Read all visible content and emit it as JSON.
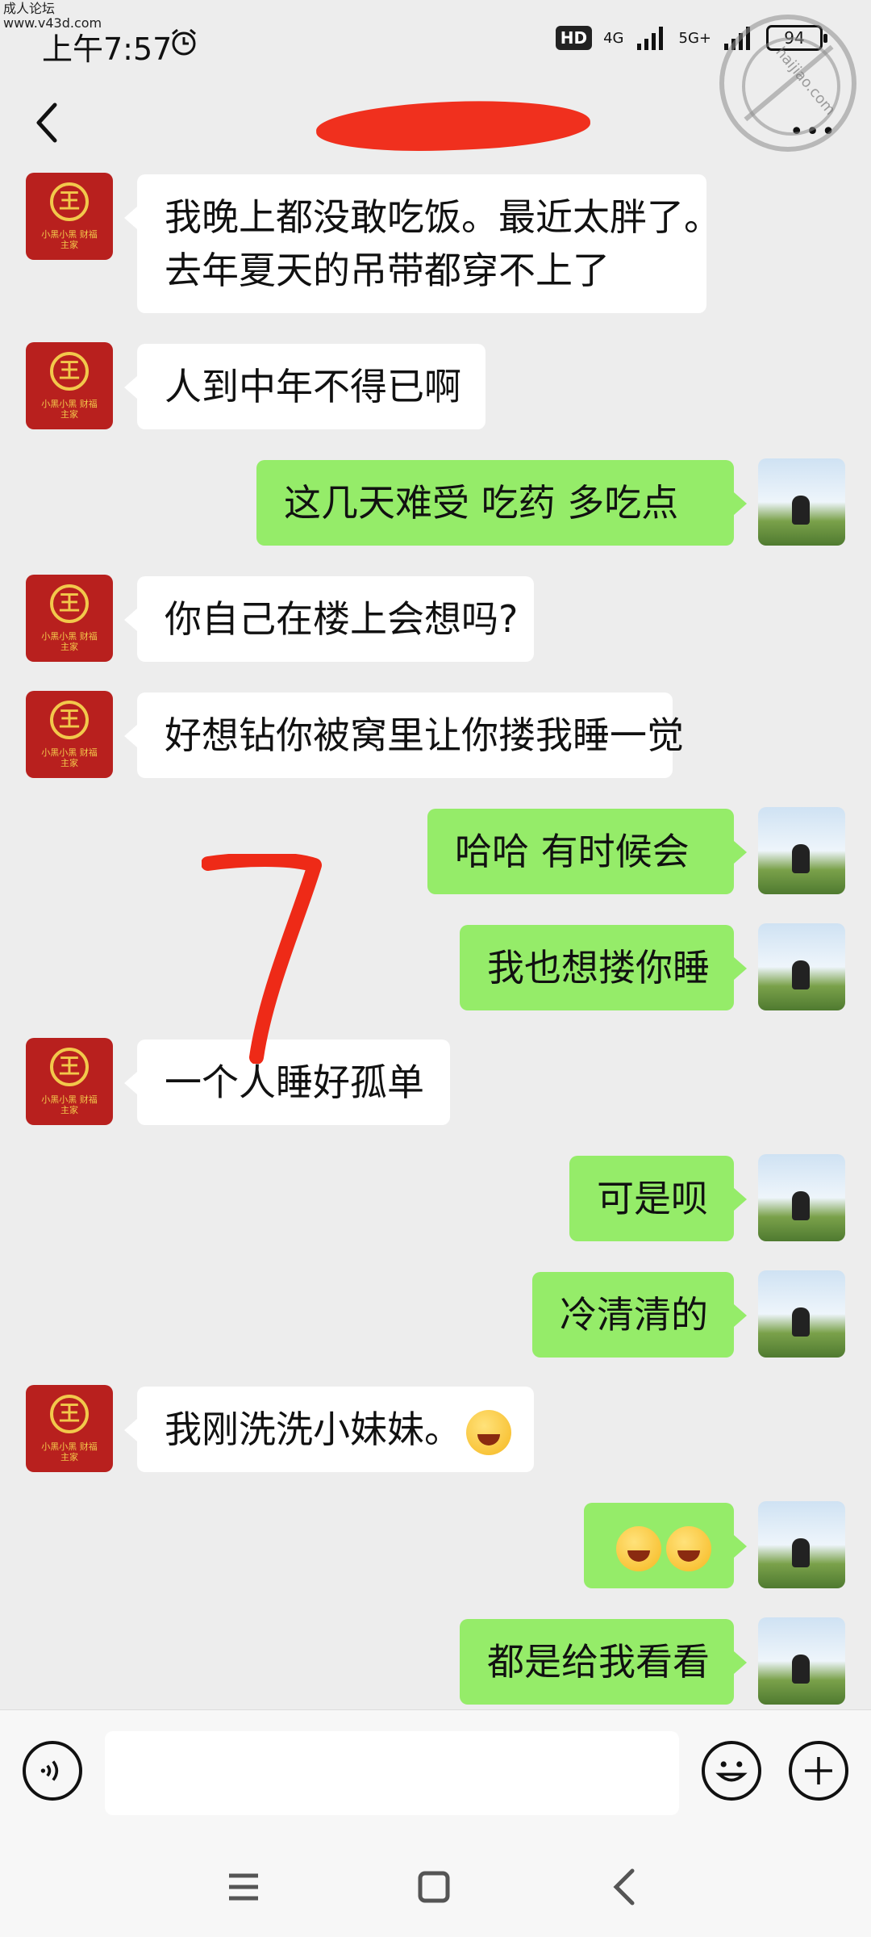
{
  "watermark": {
    "line1": "成人论坛",
    "line2": "www.v43d.com",
    "stamp_text": "haijiao.com"
  },
  "status_bar": {
    "time": "上午7:57",
    "hd": "HD",
    "net1": "4G",
    "net2": "5G+",
    "battery": "94"
  },
  "nav": {
    "title": "",
    "more": "•••"
  },
  "messages": [
    {
      "side": "left",
      "lines": [
        "我晚上都没敢吃饭。最近太胖了。",
        "去年夏天的吊带都穿不上了"
      ]
    },
    {
      "side": "left",
      "lines": [
        "人到中年不得已啊"
      ]
    },
    {
      "side": "right",
      "lines": [
        "这几天难受   吃药   多吃点"
      ]
    },
    {
      "side": "left",
      "lines": [
        "你自己在楼上会想吗?"
      ]
    },
    {
      "side": "left",
      "lines": [
        "好想钻你被窝里让你搂我睡一觉"
      ]
    },
    {
      "side": "right",
      "lines": [
        "哈哈    有时候会"
      ]
    },
    {
      "side": "right",
      "lines": [
        "我也想搂你睡"
      ]
    },
    {
      "side": "left",
      "lines": [
        "一个人睡好孤单"
      ]
    },
    {
      "side": "right",
      "lines": [
        "可是呗"
      ]
    },
    {
      "side": "right",
      "lines": [
        "冷清清的"
      ]
    },
    {
      "side": "left",
      "lines": [
        "我刚洗洗小妹妹。"
      ],
      "emoji": "hand-over-mouth-face"
    },
    {
      "side": "right",
      "lines": [
        ""
      ],
      "emoji": "laughing-crying-faces"
    },
    {
      "side": "right",
      "lines": [
        "都是给我看看"
      ]
    }
  ],
  "avatar_left": {
    "crest_char": "王",
    "motto": "小黑小黑 财福主家"
  },
  "input": {
    "placeholder": ""
  },
  "colors": {
    "bg": "#ededed",
    "left_bubble": "#ffffff",
    "right_bubble": "#95ec69",
    "redaction": "#f0301e"
  }
}
